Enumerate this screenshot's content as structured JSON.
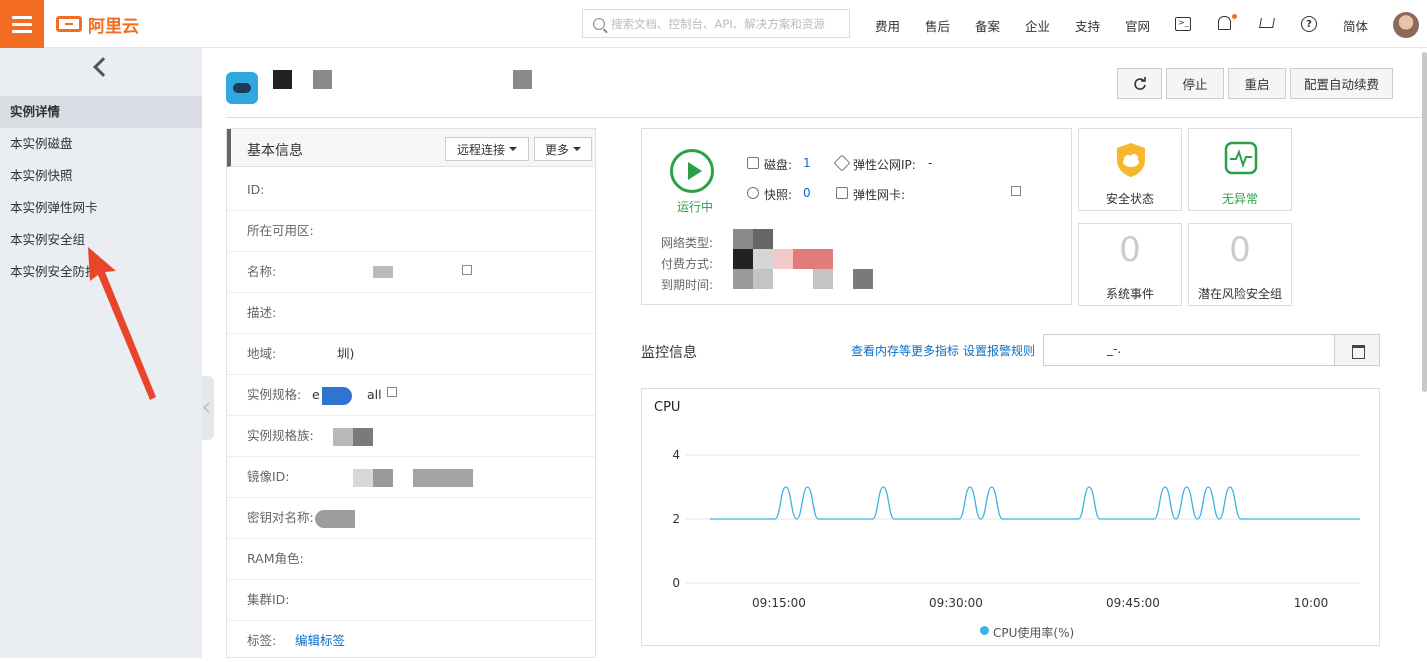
{
  "brand": {
    "name": "阿里云",
    "accent": "#f26d21"
  },
  "search": {
    "placeholder": "搜索文档、控制台、API、解决方案和资源"
  },
  "topnav": [
    "费用",
    "售后",
    "备案",
    "企业",
    "支持",
    "官网"
  ],
  "topnav_icons": [
    "terminal-icon",
    "bell-icon",
    "cart-icon",
    "help-icon"
  ],
  "lang": "简体",
  "sidebar": {
    "items": [
      {
        "label": "实例详情",
        "active": true
      },
      {
        "label": "本实例磁盘"
      },
      {
        "label": "本实例快照"
      },
      {
        "label": "本实例弹性网卡"
      },
      {
        "label": "本实例安全组"
      },
      {
        "label": "本实例安全防护"
      }
    ]
  },
  "actions": {
    "stop": "停止",
    "restart": "重启",
    "renew": "配置自动续费"
  },
  "basic": {
    "title": "基本信息",
    "remote": "远程连接",
    "more": "更多",
    "rows": [
      {
        "label": "ID:"
      },
      {
        "label": "所在可用区:"
      },
      {
        "label": "名称:"
      },
      {
        "label": "描述:"
      },
      {
        "label": "地域:",
        "value": "圳)"
      },
      {
        "label": "实例规格:",
        "value": "e",
        "value2": "all"
      },
      {
        "label": "实例规格族:"
      },
      {
        "label": "镜像ID:"
      },
      {
        "label": "密钥对名称:"
      },
      {
        "label": "RAM角色:"
      },
      {
        "label": "集群ID:"
      },
      {
        "label": "标签:",
        "link": "编辑标签"
      }
    ]
  },
  "status": {
    "running": "运行中",
    "disk_label": "磁盘:",
    "disk_value": "1",
    "snapshot_label": "快照:",
    "snapshot_value": "0",
    "eip_label": "弹性公网IP:",
    "eip_value": "-",
    "eni_label": "弹性网卡:",
    "network_label": "网络类型:",
    "pay_label": "付费方式:",
    "expire_label": "到期时间:"
  },
  "cards": [
    {
      "label": "安全状态",
      "icon": "shield-icon",
      "color": "#f5b82e"
    },
    {
      "label": "无异常",
      "icon": "heartbeat-icon",
      "color": "#2aa047"
    },
    {
      "label": "系统事件",
      "value": "0"
    },
    {
      "label": "潜在风险安全组",
      "value": "0"
    }
  ],
  "monitor": {
    "title": "监控信息",
    "link1": "查看内存等更多指标",
    "link2": "设置报警规则",
    "date_value": "_-."
  },
  "chart_data": {
    "type": "line",
    "title": "CPU",
    "x_ticks": [
      "09:15:00",
      "09:30:00",
      "09:45:00",
      "10:00"
    ],
    "y_ticks": [
      "0",
      "2",
      "4"
    ],
    "ylim": [
      0,
      4
    ],
    "legend": "bottom",
    "series": [
      {
        "name": "CPU使用率(%)",
        "color": "#3bb3e0",
        "x": [
          0,
          6,
          7,
          8,
          9,
          10,
          11,
          12,
          13,
          14,
          15,
          16,
          17,
          18,
          19,
          20,
          21,
          22,
          23,
          24,
          25,
          26,
          27,
          28,
          29,
          30,
          31,
          32,
          33,
          34,
          35,
          36,
          37,
          38,
          39,
          40,
          41,
          42,
          43,
          44,
          45,
          46,
          47,
          48,
          49,
          50,
          51,
          52,
          53,
          54,
          55,
          56,
          57,
          58,
          59,
          60
        ],
        "values": [
          2,
          2,
          3,
          2,
          3,
          2,
          2,
          2,
          2,
          2,
          2,
          3,
          2,
          2,
          2,
          2,
          2,
          2,
          2,
          3,
          2,
          3,
          2,
          2,
          2,
          2,
          2,
          2,
          2,
          2,
          3,
          2,
          2,
          2,
          2,
          2,
          2,
          3,
          2,
          3,
          2,
          3,
          2,
          3,
          2,
          2,
          2,
          2,
          2,
          2,
          2,
          2,
          2,
          2,
          2,
          2
        ]
      }
    ]
  }
}
